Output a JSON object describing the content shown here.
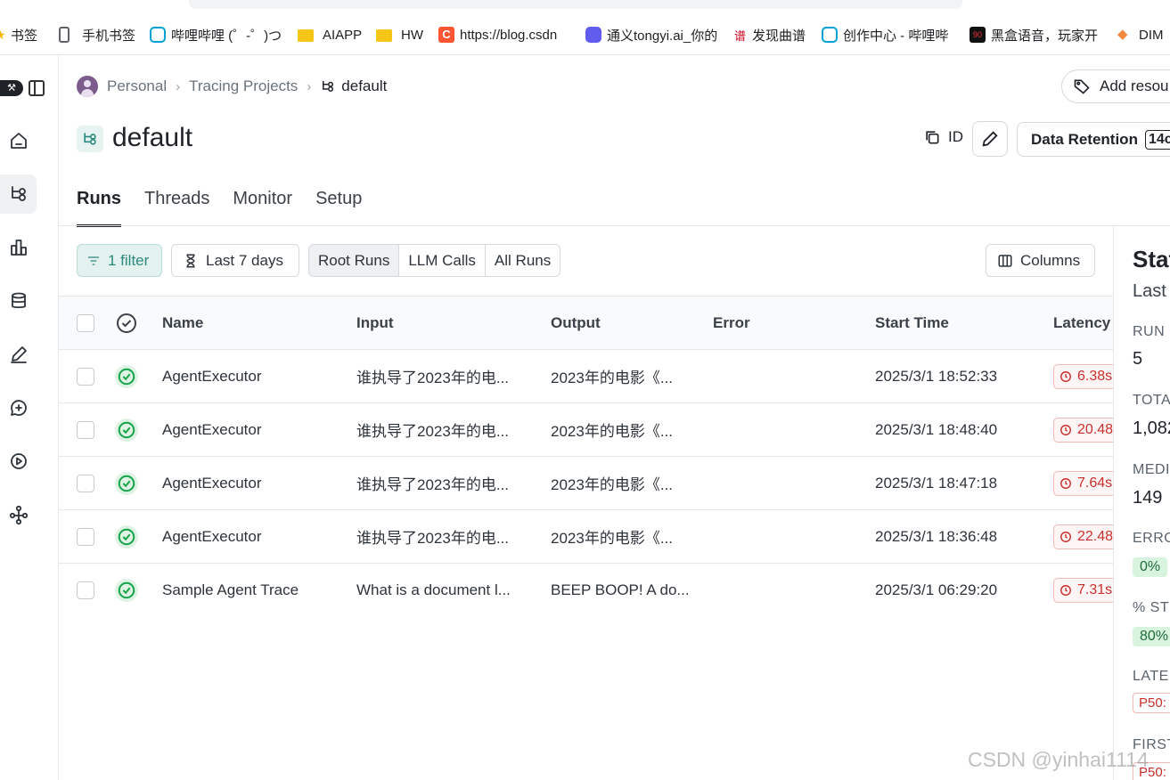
{
  "bookmarks": [
    {
      "label": "书签",
      "icon": "star-icon"
    },
    {
      "label": "手机书签",
      "icon": "phone-icon"
    },
    {
      "label": "哔哩哔哩 (゜-゜)つ",
      "icon": "bilibili-icon"
    },
    {
      "label": "AIAPP",
      "icon": "folder-icon"
    },
    {
      "label": "HW",
      "icon": "folder-icon"
    },
    {
      "label": "https://blog.csdn",
      "icon": "csdn-icon"
    },
    {
      "label": "通义tongyi.ai_你的",
      "icon": "tongyi-icon"
    },
    {
      "label": "发现曲谱",
      "icon": "qupu-icon"
    },
    {
      "label": "创作中心 - 哔哩哔",
      "icon": "bilibili-icon"
    },
    {
      "label": "黑盒语音，玩家开",
      "icon": "heihe-icon"
    },
    {
      "label": "DIM",
      "icon": "dim-icon"
    }
  ],
  "breadcrumb": {
    "personal": "Personal",
    "projects": "Tracing Projects",
    "current": "default"
  },
  "add_resource": "Add resou",
  "page_title": "default",
  "id_label": "ID",
  "retention": {
    "label": "Data Retention",
    "value": "14c"
  },
  "tabs": [
    "Runs",
    "Threads",
    "Monitor",
    "Setup"
  ],
  "toolbar": {
    "filter": "1 filter",
    "days": "Last 7 days",
    "segments": [
      "Root Runs",
      "LLM Calls",
      "All Runs"
    ],
    "columns": "Columns"
  },
  "table": {
    "headers": {
      "name": "Name",
      "input": "Input",
      "output": "Output",
      "error": "Error",
      "start": "Start Time",
      "latency": "Latency"
    },
    "rows": [
      {
        "name": "AgentExecutor",
        "input": "谁执导了2023年的电...",
        "output": "2023年的电影《...",
        "error": "",
        "start": "2025/3/1 18:52:33",
        "latency": "6.38s"
      },
      {
        "name": "AgentExecutor",
        "input": "谁执导了2023年的电...",
        "output": "2023年的电影《...",
        "error": "",
        "start": "2025/3/1 18:48:40",
        "latency": "20.48"
      },
      {
        "name": "AgentExecutor",
        "input": "谁执导了2023年的电...",
        "output": "2023年的电影《...",
        "error": "",
        "start": "2025/3/1 18:47:18",
        "latency": "7.64s"
      },
      {
        "name": "AgentExecutor",
        "input": "谁执导了2023年的电...",
        "output": "2023年的电影《...",
        "error": "",
        "start": "2025/3/1 18:36:48",
        "latency": "22.48"
      },
      {
        "name": "Sample Agent Trace",
        "input": "What is a document l...",
        "output": "BEEP BOOP! A do...",
        "error": "",
        "start": "2025/3/1 06:29:20",
        "latency": "7.31s"
      }
    ]
  },
  "stats": {
    "title": "Stat",
    "subtitle": "Last",
    "run_label": "RUN C",
    "run_value": "5",
    "total_label": "TOTA",
    "total_value": "1,082",
    "median_label": "MEDI",
    "median_value": "149",
    "error_label": "ERRO",
    "error_value": "0%",
    "streaming_label": "% ST",
    "streaming_value": "80%",
    "latency_label": "LATE",
    "latency_value": "P50:",
    "first_label": "FIRST",
    "first_value": "P50:"
  },
  "watermark": "CSDN @yinhai1114",
  "colors": {
    "accent": "#2b8a7e",
    "success": "#16a34a",
    "latency_red": "#c9302c"
  }
}
